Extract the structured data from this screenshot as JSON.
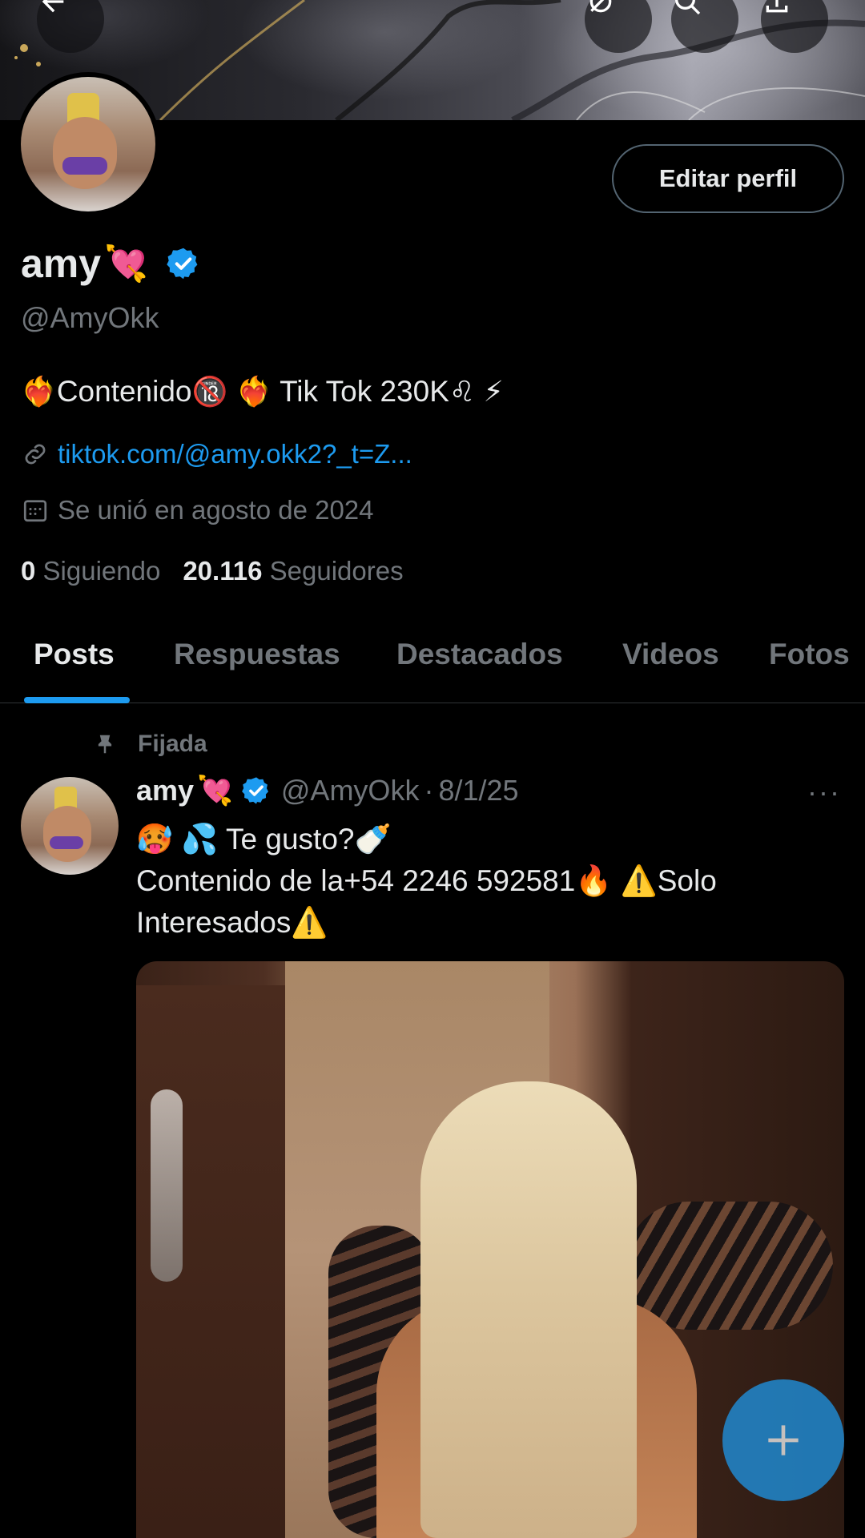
{
  "profile": {
    "display_name": "amy",
    "name_emoji": "💘",
    "handle": "@AmyOkk",
    "bio": {
      "e1": "❤️‍🔥",
      "t1": "Contenido",
      "e2": "🔞",
      "e3": "❤️‍🔥",
      "t2": " Tik Tok 230K",
      "e4": "♌",
      "e5": "⚡"
    },
    "link": "tiktok.com/@amy.okk2?_t=Z...",
    "joined": "Se unió en agosto de 2024",
    "following_count": "0",
    "following_label": "Siguiendo",
    "followers_count": "20.116",
    "followers_label": "Seguidores",
    "edit_button": "Editar perfil"
  },
  "tabs": [
    {
      "label": "Posts"
    },
    {
      "label": "Respuestas"
    },
    {
      "label": "Destacados"
    },
    {
      "label": "Videos"
    },
    {
      "label": "Fotos"
    }
  ],
  "post": {
    "pinned_label": "Fijada",
    "name": "amy",
    "name_emoji": "💘",
    "handle": "@AmyOkk",
    "separator": "·",
    "date": "8/1/25",
    "more": "···",
    "line1": {
      "e1": "🥵",
      "e2": "💦",
      "t": " Te gusto?",
      "e3": "🍼"
    },
    "line2": {
      "t1": "Contenido de la+54 2246 592581",
      "e1": "🔥",
      "e2": "⚠️",
      "t2": "Solo"
    },
    "line3": {
      "t": "Interesados",
      "e": "⚠️"
    }
  },
  "colors": {
    "accent": "#1d9bf0",
    "background": "#000000",
    "text_primary": "#e7e9ea",
    "text_secondary": "#71767b"
  },
  "icons": [
    "back-arrow-icon",
    "grok-icon",
    "search-icon",
    "share-icon",
    "verified-badge-icon",
    "link-icon",
    "calendar-icon",
    "pin-icon",
    "compose-plus-icon"
  ]
}
